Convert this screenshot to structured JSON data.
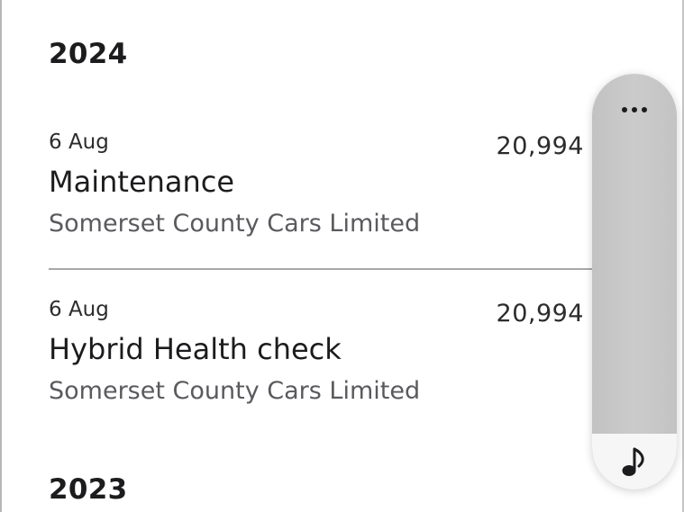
{
  "history": {
    "years": [
      {
        "year": "2024",
        "records": [
          {
            "date": "6 Aug",
            "mileage": "20,994",
            "title": "Maintenance",
            "dealer": "Somerset County Cars Limited"
          },
          {
            "date": "6 Aug",
            "mileage": "20,994",
            "title": "Hybrid Health check",
            "dealer": "Somerset County Cars Limited"
          }
        ]
      },
      {
        "year": "2023",
        "records": []
      }
    ]
  },
  "side_panel": {
    "more_icon": "ellipsis-icon",
    "audio_icon": "music-note-icon"
  },
  "colors": {
    "text_primary": "#1c1c1e",
    "text_secondary": "#5a5a5e",
    "divider": "#a8a8a8",
    "panel_bg": "#c8c8c8"
  }
}
